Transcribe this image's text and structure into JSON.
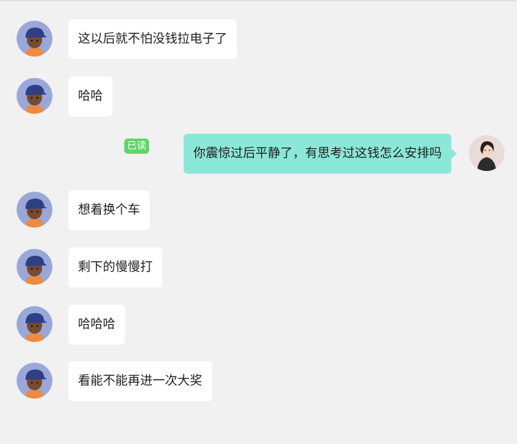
{
  "messages": [
    {
      "side": "left",
      "text": "这以后就不怕没钱拉电子了",
      "avatar": "cartoon-boy-cap-avatar"
    },
    {
      "side": "left",
      "text": "哈哈",
      "avatar": "cartoon-boy-cap-avatar"
    },
    {
      "side": "right",
      "text": "你震惊过后平静了，有思考过这钱怎么安排吗",
      "avatar": "woman-portrait-avatar",
      "status": "已读"
    },
    {
      "side": "left",
      "text": "想着换个车",
      "avatar": "cartoon-boy-cap-avatar"
    },
    {
      "side": "left",
      "text": "剩下的慢慢打",
      "avatar": "cartoon-boy-cap-avatar"
    },
    {
      "side": "left",
      "text": "哈哈哈",
      "avatar": "cartoon-boy-cap-avatar"
    },
    {
      "side": "left",
      "text": "看能不能再进一次大奖",
      "avatar": "cartoon-boy-cap-avatar"
    }
  ],
  "colors": {
    "background": "#f1f1f1",
    "left_bubble": "#ffffff",
    "right_bubble": "#8be8d8",
    "read_badge": "#5fd56b"
  }
}
